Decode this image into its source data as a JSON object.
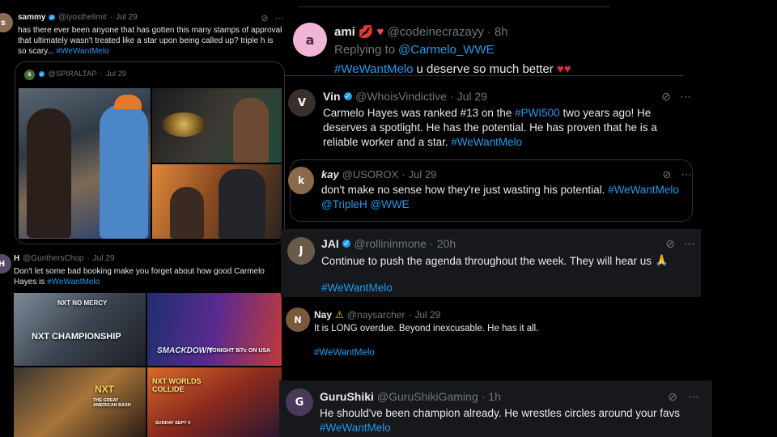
{
  "left": {
    "t1": {
      "name": "sammy",
      "handle": "@iyosthelimit",
      "time": "Jul 29",
      "text": "has there ever been anyone that has gotten this many stamps of approval that ultimately wasn't treated like a star upon being called up? triple h is so scary...",
      "hashtag": "#WeWantMelo",
      "quote": {
        "handle": "@SPIRALTAP",
        "time": "Jul 29"
      }
    },
    "t2": {
      "name": "H",
      "handle": "@GunthersChop",
      "time": "Jul 29",
      "text": "Don't let some bad booking make you forget about how good Carmelo Hayes is",
      "hashtag": "#WeWantMelo",
      "images": {
        "a_title": "NXT NO MERCY",
        "a_sub": "NXT CHAMPIONSHIP",
        "b_title": "SMACKDOWN",
        "b_sub": "TONIGHT 8/7c ON USA",
        "c_title": "NXT",
        "c_sub": "THE GREAT AMERICAN BASH",
        "d_title": "NXT WORLDS COLLIDE",
        "d_sub": "SUNDAY SEPT 4"
      }
    }
  },
  "right": {
    "r0": {
      "name": "ami",
      "handle": "@codeinecrazayy",
      "time": "8h",
      "reply_label": "Replying to",
      "reply_to": "@Carmelo_WWE",
      "hashtag": "#WeWantMelo",
      "text": "u deserve so much better"
    },
    "r1": {
      "name": "Vin",
      "handle": "@WhoisVindictive",
      "time": "Jul 29",
      "text_a": "Carmelo Hayes was ranked #13 on the",
      "hashtag_a": "#PWI500",
      "text_b": "two years ago! He deserves a spotlight. He has the potential. He has proven that he is a reliable worker and a star.",
      "hashtag_b": "#WeWantMelo",
      "quote": {
        "name": "kay",
        "handle": "@USOROX",
        "time": "Jul 29",
        "text": "don't make no sense how they're just wasting his potential.",
        "tags": "#WeWantMelo @TripleH @WWE"
      }
    },
    "r2": {
      "name": "JAI",
      "handle": "@rollininmone",
      "time": "20h",
      "text": "Continue to push the agenda throughout the week. They will hear us",
      "hashtag": "#WeWantMelo"
    },
    "r3": {
      "name": "Nay",
      "handle": "@naysarcher",
      "time": "Jul 29",
      "text": "It is LONG overdue. Beyond inexcusable. He has it all.",
      "hashtag": "#WeWantMelo"
    },
    "r4": {
      "name": "GuruShiki",
      "handle": "@GuruShikiGaming",
      "time": "1h",
      "text": "He should've been champion already. He wrestles circles around your favs",
      "hashtag": "#WeWantMelo"
    }
  },
  "icons": {
    "verified": "verified-badge-icon",
    "grok": "grok-icon",
    "more": "more-icon",
    "heart": "heart-emoji",
    "lips": "lips-emoji",
    "pray": "pray-emoji",
    "warning": "warning-emoji"
  },
  "colors": {
    "background": "#000000",
    "text": "#e7e9ea",
    "secondary": "#71767b",
    "link": "#1d9bf0",
    "panel": "#16181c",
    "verified": "#1d9bf0"
  }
}
